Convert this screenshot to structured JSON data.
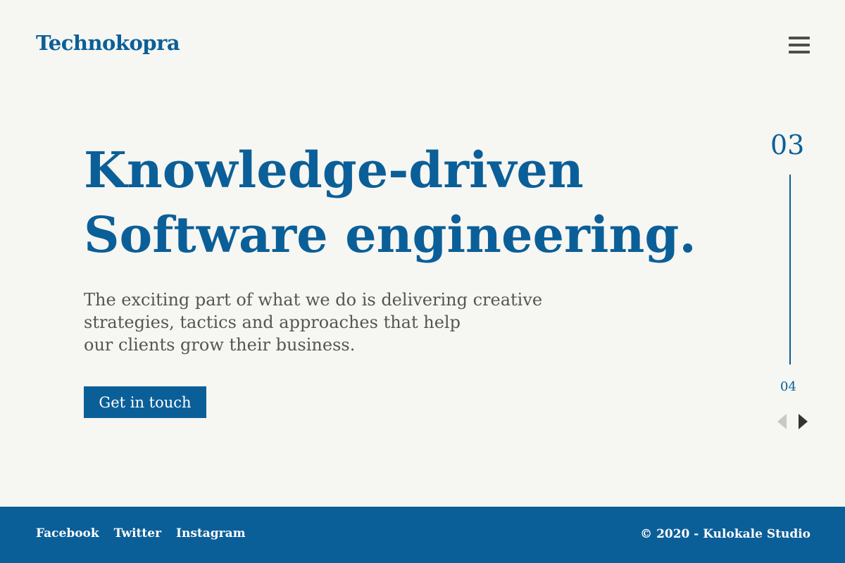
{
  "header": {
    "logo": "Technokopra",
    "menu_icon": "hamburger-menu-icon"
  },
  "hero": {
    "title_line1": "Knowledge-driven",
    "title_line2": "Software engineering.",
    "lede_line1": "The exciting part of what we do is delivering creative",
    "lede_line2": "strategies, tactics and approaches that help",
    "lede_line3": "our clients grow their business.",
    "cta_label": "Get in touch"
  },
  "slider": {
    "current": "03",
    "next": "04",
    "prev_icon": "arrow-left-icon",
    "next_icon": "arrow-right-icon"
  },
  "footer": {
    "social": [
      "Facebook",
      "Twitter",
      "Instagram"
    ],
    "copyright": "© 2020 - Kulokale Studio"
  },
  "colors": {
    "brand": "#0b5f98",
    "background": "#f6f6f2",
    "body_text": "#555555"
  }
}
